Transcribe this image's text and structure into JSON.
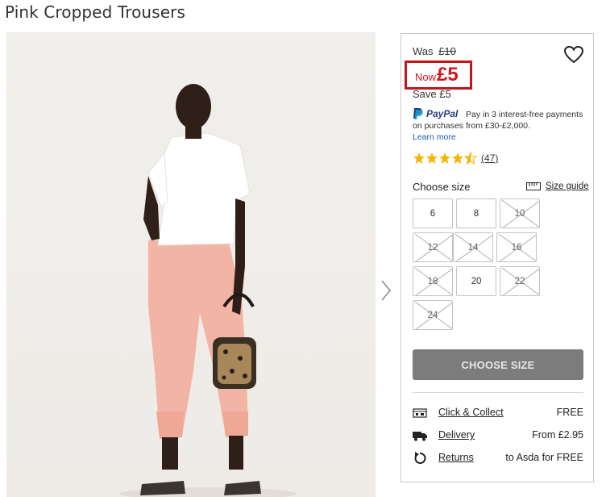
{
  "page": {
    "title": "Pink Cropped Trousers"
  },
  "price": {
    "was_label": "Was",
    "was_value": "£10",
    "now_label": "Now",
    "now_value": "£5",
    "save_text": "Save £5",
    "accent_color": "#d3161e"
  },
  "paypal": {
    "brand_text": "PayPal",
    "message": "Pay in 3 interest-free payments on purchases from £30-£2,000.",
    "learn_more": "Learn more"
  },
  "rating": {
    "stars": 4.5,
    "max_stars": 5,
    "review_count": "(47)",
    "star_color": "#f5b400"
  },
  "sizes": {
    "label": "Choose size",
    "guide_label": "Size guide",
    "options": [
      {
        "size": "6",
        "available": true
      },
      {
        "size": "8",
        "available": true
      },
      {
        "size": "10",
        "available": false
      },
      {
        "size": "12",
        "available": false
      },
      {
        "size": "14",
        "available": false
      },
      {
        "size": "16",
        "available": false
      },
      {
        "size": "18",
        "available": false
      },
      {
        "size": "20",
        "available": true
      },
      {
        "size": "22",
        "available": false
      },
      {
        "size": "24",
        "available": false
      }
    ]
  },
  "cta": {
    "label": "CHOOSE SIZE"
  },
  "services": [
    {
      "icon": "store-icon",
      "link": "Click & Collect",
      "value": "FREE"
    },
    {
      "icon": "truck-icon",
      "link": "Delivery",
      "value": "From £2.95"
    },
    {
      "icon": "return-icon",
      "link": "Returns",
      "value": "to Asda for FREE"
    }
  ],
  "icons": {
    "wishlist": "heart-icon",
    "next": "chevron-right-icon",
    "size_guide": "ruler-icon"
  }
}
